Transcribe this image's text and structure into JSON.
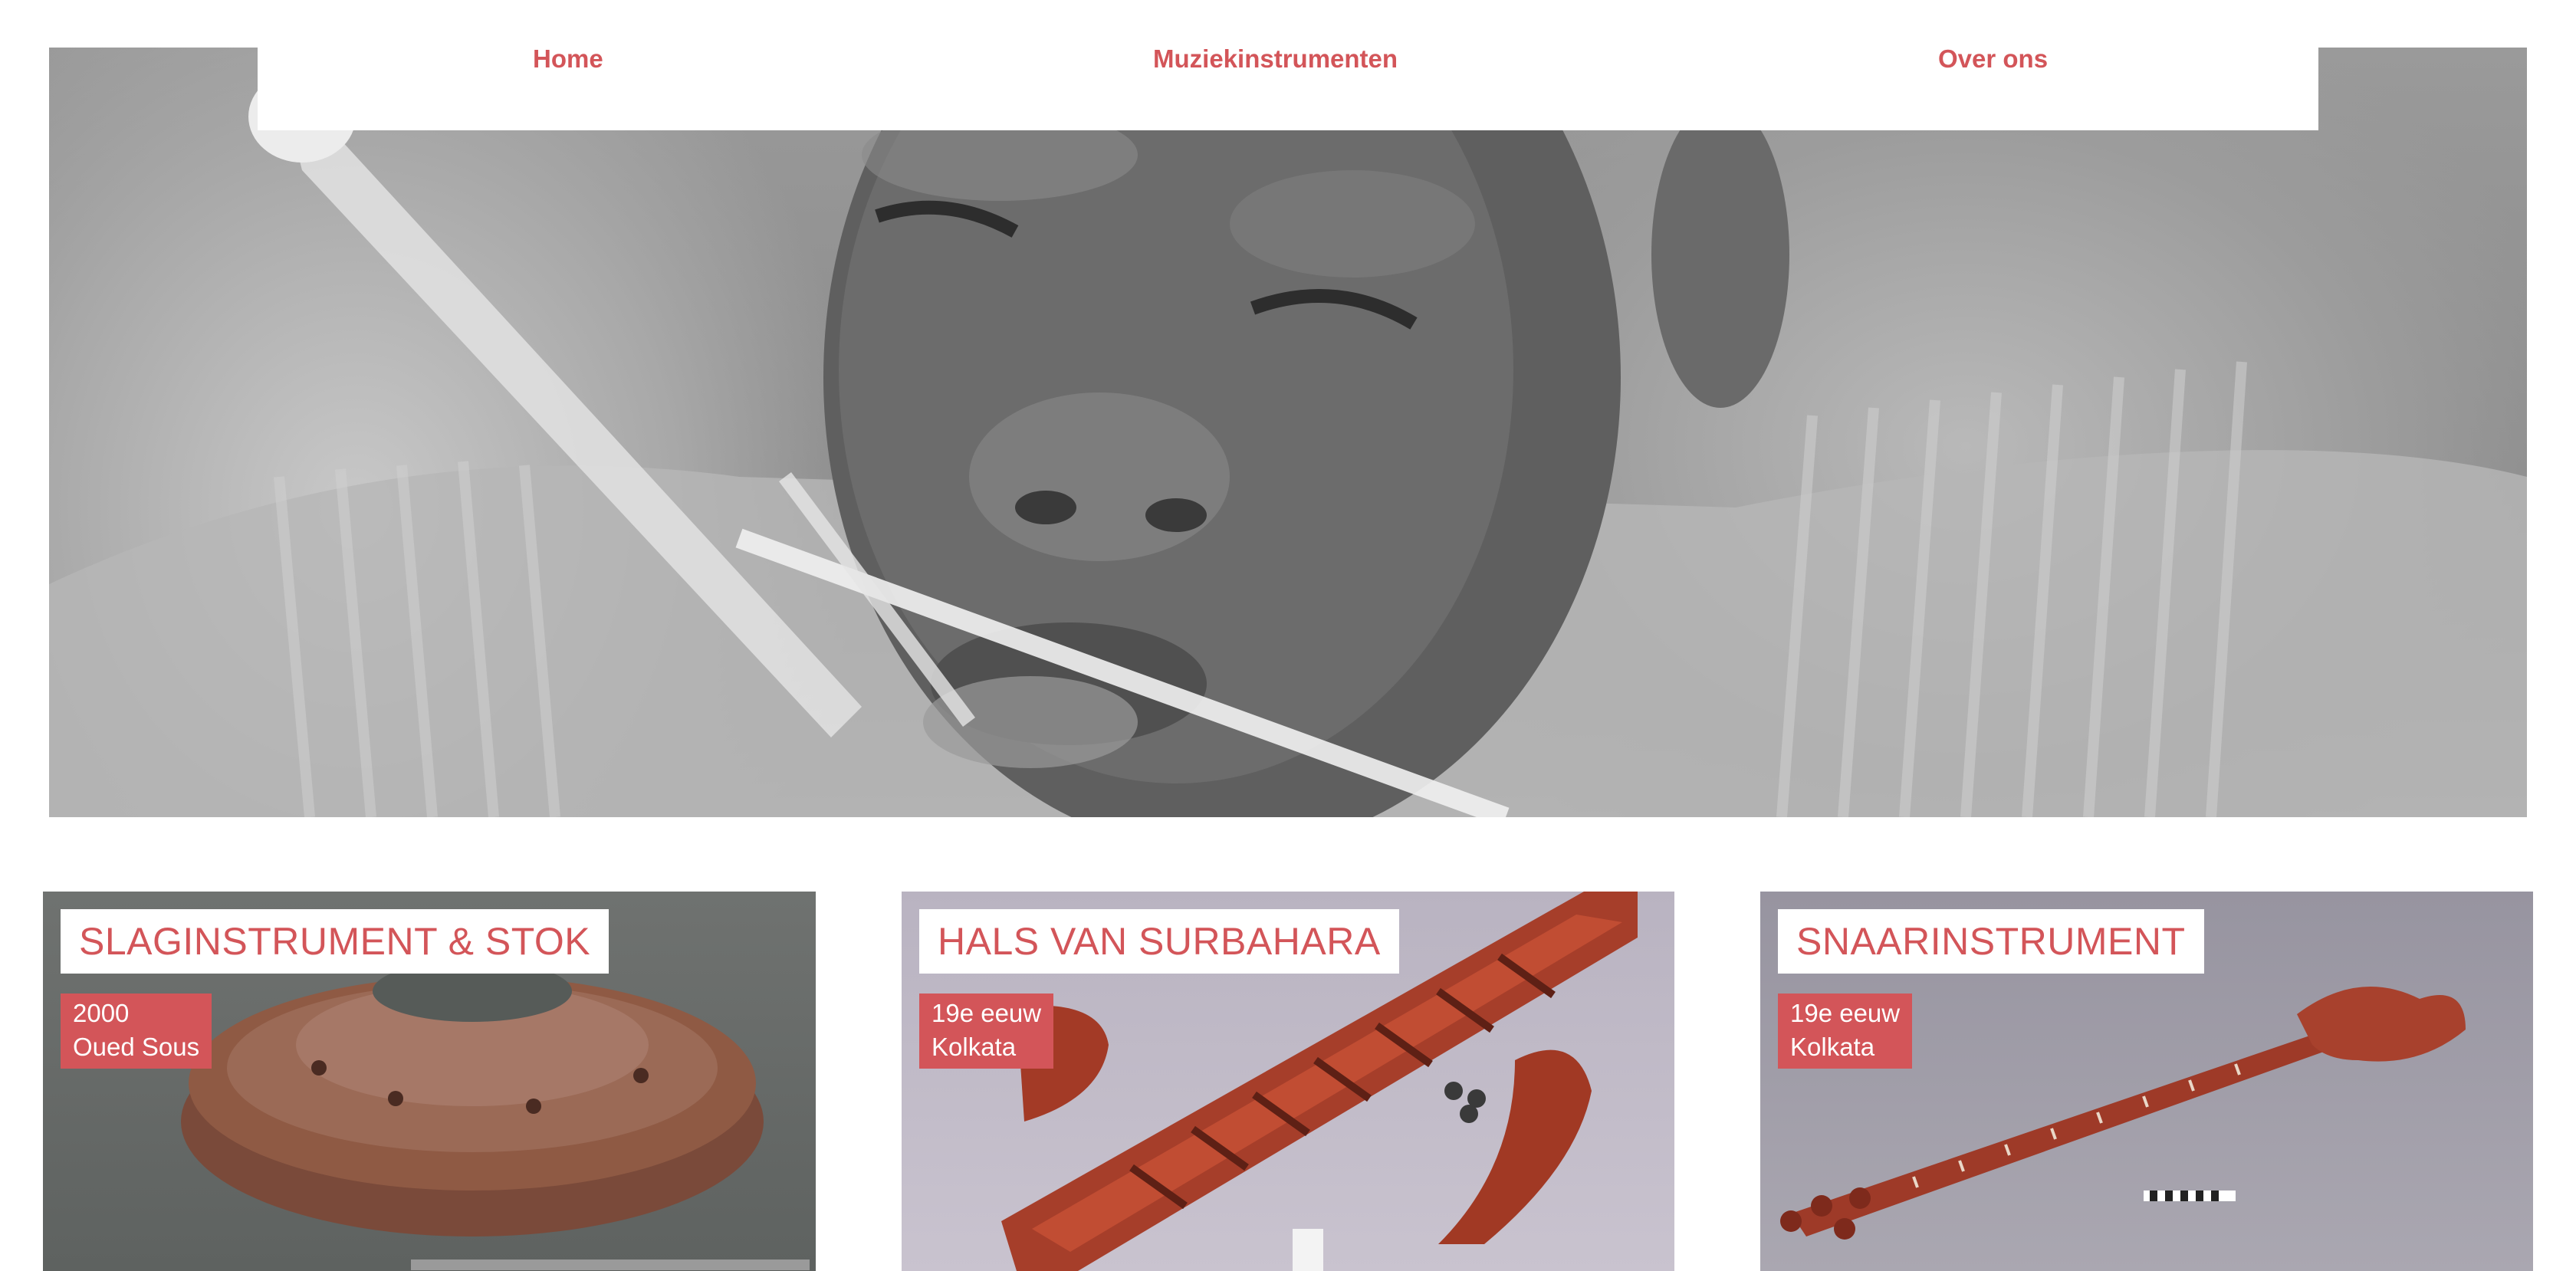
{
  "nav": {
    "items": [
      {
        "label": "Home"
      },
      {
        "label": "Muziekinstrumenten"
      },
      {
        "label": "Over ons"
      }
    ]
  },
  "hero": {
    "image": "black-and-white photo of man playing a mouth bow"
  },
  "cards": [
    {
      "title": "SLAGINSTRUMENT & STOK",
      "date": "2000",
      "place": "Oued Sous",
      "image": "drum-and-stick-photo"
    },
    {
      "title": "HALS VAN SURBAHARA",
      "date": "19e eeuw",
      "place": "Kolkata",
      "image": "surbahar-neck-photo"
    },
    {
      "title": "SNAARINSTRUMENT",
      "date": "19e eeuw",
      "place": "Kolkata",
      "image": "string-instrument-photo"
    }
  ],
  "colors": {
    "accent": "#d35559",
    "background": "#ffffff"
  }
}
